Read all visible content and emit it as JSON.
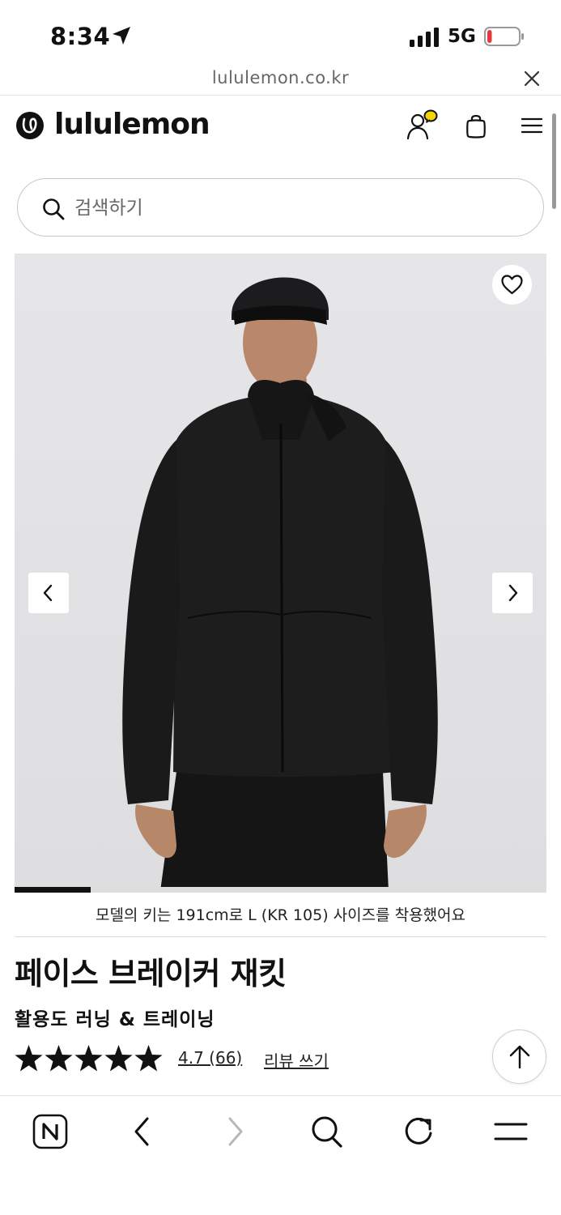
{
  "status_bar": {
    "time": "8:34",
    "network": "5G",
    "battery_level": 0.15,
    "battery_color": "#e5383b"
  },
  "browser": {
    "url": "lululemon.co.kr"
  },
  "header": {
    "logo_text": "lululemon",
    "account_badge_color": "#f5d400"
  },
  "search": {
    "placeholder": "검색하기"
  },
  "gallery": {
    "progress": 0.143,
    "icons": [
      "heart-icon",
      "chevron-left-icon",
      "chevron-right-icon"
    ]
  },
  "product": {
    "model_caption": "모델의 키는 191cm로 L (KR 105) 사이즈를 착용했어요",
    "title": "페이스 브레이커 재킷",
    "activity": "활용도 러닝 & 트레이닝",
    "stars": 5,
    "rating_text": "4.7 (66)",
    "review_link": "리뷰 쓰기"
  },
  "toolbar": {
    "icons": [
      "naver-n-icon",
      "back-icon",
      "forward-icon",
      "search-icon",
      "reload-icon",
      "menu-icon"
    ]
  }
}
